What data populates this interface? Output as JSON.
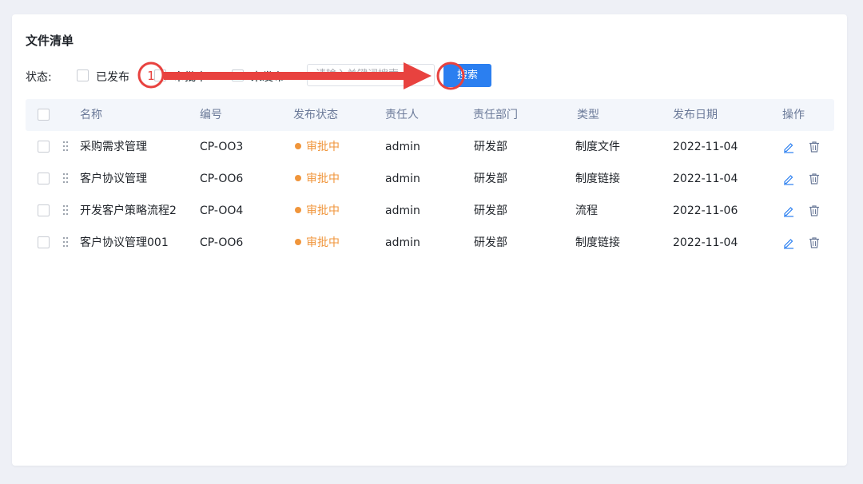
{
  "page": {
    "title": "文件清单"
  },
  "filter": {
    "label": "状态:",
    "options": [
      {
        "label": "已发布",
        "checked": false
      },
      {
        "label": "审批中",
        "checked": false
      },
      {
        "label": "未发布",
        "checked": false
      }
    ],
    "search_placeholder": "请输入关键词搜索",
    "search_button": "搜索"
  },
  "table": {
    "headers": {
      "name": "名称",
      "code": "编号",
      "status": "发布状态",
      "owner": "责任人",
      "department": "责任部门",
      "type": "类型",
      "date": "发布日期",
      "actions": "操作"
    },
    "rows": [
      {
        "name": "采购需求管理",
        "code": "CP-OO3",
        "status": "审批中",
        "owner": "admin",
        "department": "研发部",
        "type": "制度文件",
        "date": "2022-11-04"
      },
      {
        "name": "客户协议管理",
        "code": "CP-OO6",
        "status": "审批中",
        "owner": "admin",
        "department": "研发部",
        "type": "制度链接",
        "date": "2022-11-04"
      },
      {
        "name": "开发客户策略流程2",
        "code": "CP-OO4",
        "status": "审批中",
        "owner": "admin",
        "department": "研发部",
        "type": "流程",
        "date": "2022-11-06"
      },
      {
        "name": "客户协议管理001",
        "code": "CP-OO6",
        "status": "审批中",
        "owner": "admin",
        "department": "研发部",
        "type": "制度链接",
        "date": "2022-11-04"
      }
    ]
  },
  "annotation": {
    "step_number": "1",
    "color": "#e8423f"
  },
  "colors": {
    "accent": "#2b7ff0",
    "pending": "#f0953b",
    "header_text": "#6b7a99"
  },
  "icons": {
    "edit": "edit-icon",
    "delete": "trash-icon",
    "drag": "drag-handle-icon"
  }
}
